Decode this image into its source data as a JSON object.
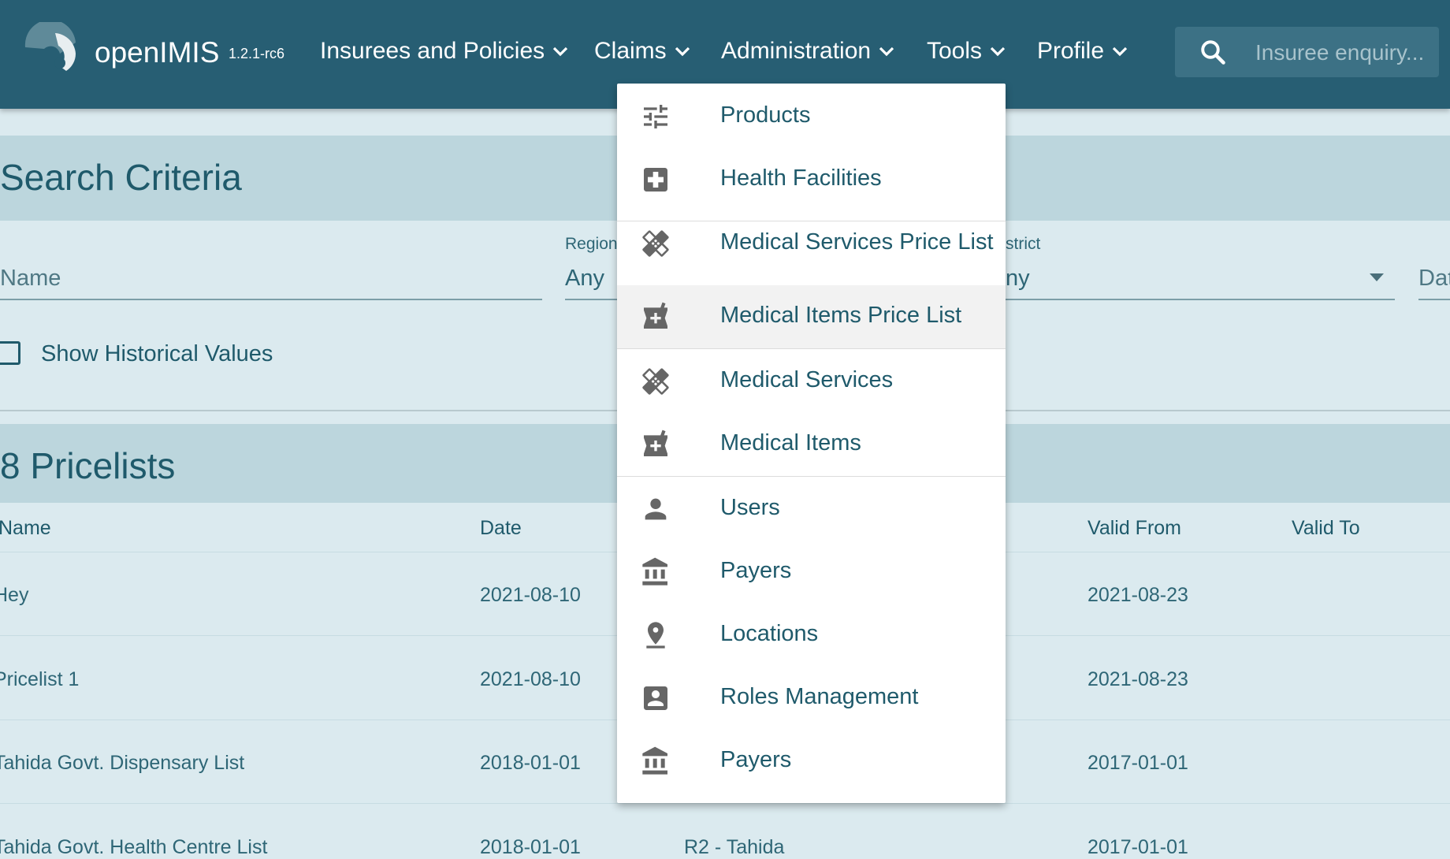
{
  "header": {
    "brand": "openIMIS",
    "version": "1.2.1-rc6",
    "nav": [
      {
        "label": "Insurees and Policies"
      },
      {
        "label": "Claims"
      },
      {
        "label": "Administration"
      },
      {
        "label": "Tools"
      },
      {
        "label": "Profile"
      }
    ],
    "search": {
      "placeholder": "Insuree enquiry..."
    }
  },
  "search_panel": {
    "title": "Search Criteria",
    "fields": {
      "name_placeholder": "Name",
      "region_label": "Region",
      "region_value": "Any",
      "district_label": "strict",
      "district_value": "ny",
      "date_partial": "Dat"
    },
    "historical_label": "Show Historical Values"
  },
  "results_panel": {
    "title": "8 Pricelists",
    "columns": [
      "Name",
      "Date",
      "Valid From",
      "Valid To"
    ],
    "rows": [
      {
        "name": "Hey",
        "date": "2021-08-10",
        "region": "",
        "valid_from": "2021-08-23",
        "valid_to": ""
      },
      {
        "name": "Pricelist 1",
        "date": "2021-08-10",
        "region": "",
        "valid_from": "2021-08-23",
        "valid_to": ""
      },
      {
        "name": "Tahida Govt. Dispensary List",
        "date": "2018-01-01",
        "region": "",
        "valid_from": "2017-01-01",
        "valid_to": ""
      },
      {
        "name": "Tahida Govt. Health Centre List",
        "date": "2018-01-01",
        "region": "R2 - Tahida",
        "valid_from": "2017-01-01",
        "valid_to": ""
      }
    ]
  },
  "admin_menu": {
    "items": [
      {
        "label": "Products",
        "icon": "tune-icon"
      },
      {
        "label": "Health Facilities",
        "icon": "hospital-box-icon"
      },
      {
        "label": "Medical Services Price List",
        "icon": "healing-icon"
      },
      {
        "label": "Medical Items Price List",
        "icon": "local-pharmacy-icon"
      },
      {
        "label": "Medical Services",
        "icon": "healing-icon"
      },
      {
        "label": "Medical Items",
        "icon": "local-pharmacy-icon"
      },
      {
        "label": "Users",
        "icon": "person-icon"
      },
      {
        "label": "Payers",
        "icon": "bank-icon"
      },
      {
        "label": "Locations",
        "icon": "pin-drop-icon"
      },
      {
        "label": "Roles Management",
        "icon": "account-box-icon"
      },
      {
        "label": "Payers",
        "icon": "bank-icon"
      }
    ]
  },
  "colors": {
    "appbar": "#275e73",
    "panel_head": "#bcd6dd",
    "panel_body": "#dbeaef",
    "text": "#1f5a6b",
    "menu_icon": "#666666"
  }
}
